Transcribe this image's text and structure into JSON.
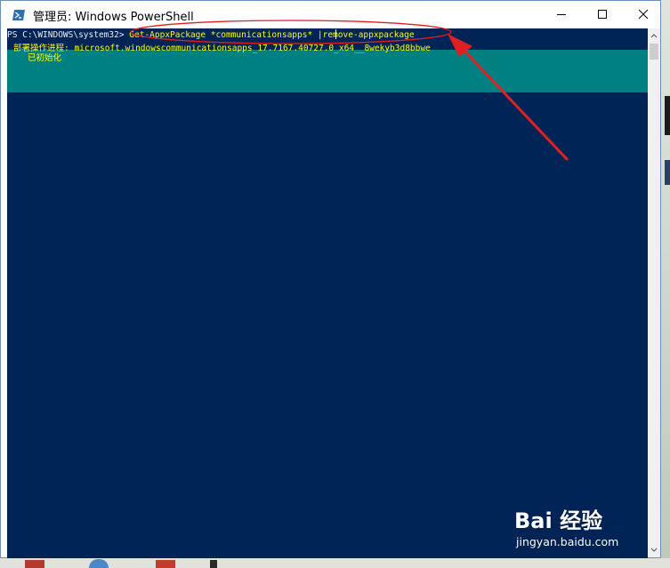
{
  "window": {
    "title": "管理员: Windows PowerShell",
    "minimize_glyph": "—",
    "maximize_glyph": "☐",
    "close_glyph": "✕"
  },
  "console": {
    "prompt": "PS C:\\WINDOWS\\system32> ",
    "command": "Get-AppxPackage *communicationsapps* |remove-appxpackage",
    "progress_line1": "部署操作进程: microsoft.windowscommunicationsapps_17.7167.40727.0_x64__8wekyb3d8bbwe",
    "progress_line2": "已初始化"
  },
  "colors": {
    "console_bg": "#012456",
    "progress_bg": "#008080",
    "command_text": "#ffff00",
    "annotation_red": "#e02020"
  },
  "watermark": {
    "logo": "Bai 经验",
    "url": "jingyan.baidu.com"
  }
}
